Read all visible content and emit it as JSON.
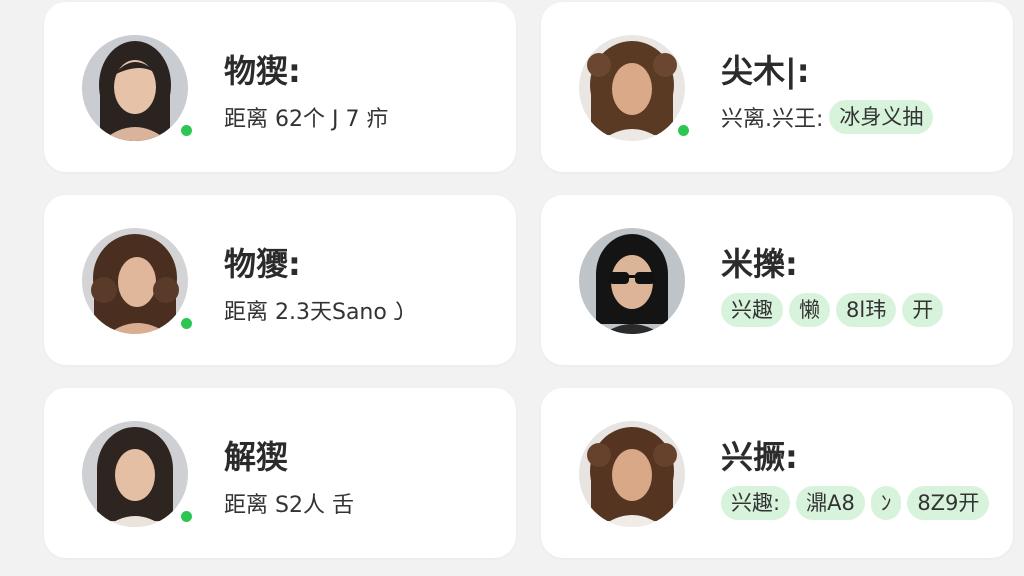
{
  "theme": {
    "online_color": "#2dc653",
    "tag_bg": "#d8f3dc",
    "card_bg": "#ffffff",
    "page_bg": "#f2f2f3"
  },
  "cards": [
    {
      "name": "物猰:",
      "distance": "距离 62个 J 7 疖",
      "tags": [],
      "avatar_icon": "woman-portrait-icon",
      "online": true
    },
    {
      "name": "尖木|:",
      "distance": "兴离.兴王:",
      "tags": [
        "冰身义抽"
      ],
      "avatar_icon": "woman-portrait-icon",
      "online": true
    },
    {
      "name": "物獿:",
      "distance": "距离 2.3天Sano㇁",
      "tags": [],
      "avatar_icon": "woman-portrait-icon",
      "online": true
    },
    {
      "name": "米擽:",
      "distance": "",
      "tags": [
        "兴趣",
        "懒",
        "8l玮",
        "开"
      ],
      "avatar_icon": "man-sunglasses-portrait-icon",
      "online": false
    },
    {
      "name": "解猰",
      "distance": "距离 S2人 舌",
      "tags": [],
      "avatar_icon": "woman-portrait-icon",
      "online": true
    },
    {
      "name": "兴撅:",
      "distance": "",
      "tags": [
        "兴趣:",
        "濎A8",
        "ﾝ",
        "8Z9开"
      ],
      "avatar_icon": "woman-portrait-icon",
      "online": false
    }
  ]
}
